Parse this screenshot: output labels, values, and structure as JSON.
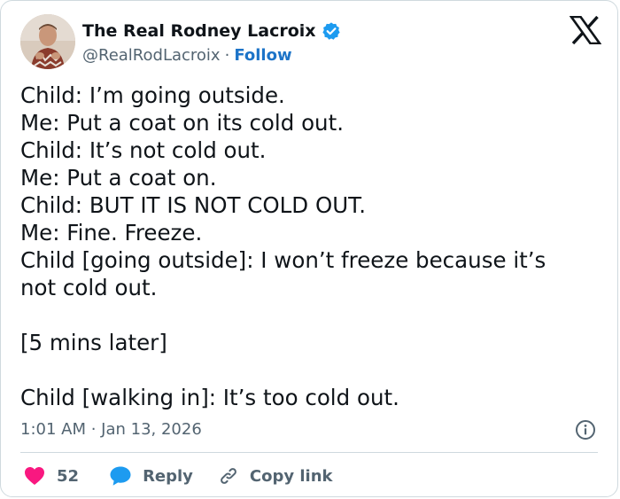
{
  "author": {
    "name": "The Real Rodney Lacroix",
    "handle": "@RealRodLacroix",
    "separator": "·",
    "follow_label": "Follow",
    "verified": true
  },
  "tweet": {
    "lines": [
      "Child: I’m going outside.",
      "Me: Put a coat on its cold out.",
      "Child: It’s not cold out.",
      "Me: Put a coat on.",
      "Child: BUT IT IS NOT COLD OUT.",
      "Me: Fine. Freeze.",
      "Child [going outside]: I won’t freeze because it’s",
      "not cold out.",
      "",
      "[5 mins later]",
      "",
      "Child [walking in]: It’s too cold out."
    ],
    "timestamp": "1:01 AM · Jan 13, 2026"
  },
  "actions": {
    "like_count": "52",
    "reply_label": "Reply",
    "copy_link_label": "Copy link"
  },
  "icons": {
    "logo": "x-logo-icon",
    "verified": "verified-badge-icon",
    "info": "info-icon",
    "like": "heart-icon",
    "reply": "speech-bubble-icon",
    "copy": "link-icon"
  },
  "colors": {
    "text": "#0f1419",
    "secondary": "#536471",
    "link": "#1d74c8",
    "verified": "#1d9bf0",
    "heart": "#f91880",
    "reply": "#1d9bf0",
    "border": "#cfd9de"
  }
}
